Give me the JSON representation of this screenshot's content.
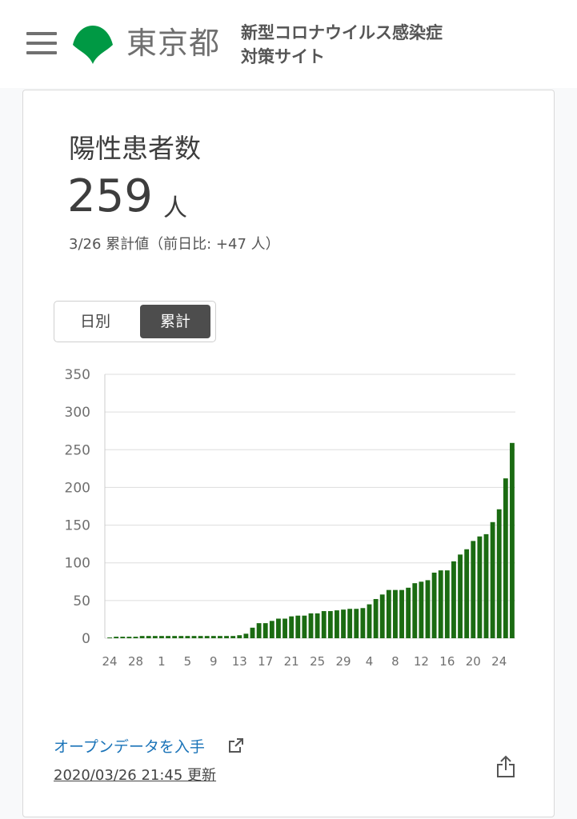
{
  "header": {
    "org_name": "東京都",
    "site_title_line1": "新型コロナウイルス感染症",
    "site_title_line2": "対策サイト",
    "menu_icon": "hamburger-menu-icon",
    "logo_icon": "tokyo-ginkgo-logo-icon",
    "logo_color": "#009944"
  },
  "card": {
    "title": "陽性患者数",
    "value": "259",
    "unit": "人",
    "sub_info": "3/26 累計値（前日比: +47 人）",
    "toggle": {
      "daily": "日別",
      "cumulative": "累計",
      "selected": "cumulative"
    },
    "open_data_link": "オープンデータを入手",
    "open_data_icon": "external-link-icon",
    "updated": "2020/03/26 21:45 更新",
    "share_icon": "share-icon"
  },
  "chart_data": {
    "type": "bar",
    "color": "#1b6b12",
    "ylim": [
      0,
      350
    ],
    "yticks": [
      0,
      50,
      100,
      150,
      200,
      250,
      300,
      350
    ],
    "xtick_labels": [
      "24",
      "28",
      "1",
      "5",
      "9",
      "13",
      "17",
      "21",
      "25",
      "29",
      "4",
      "8",
      "12",
      "16",
      "20",
      "24"
    ],
    "xtick_indices": [
      0,
      4,
      8,
      12,
      16,
      20,
      24,
      28,
      32,
      36,
      40,
      44,
      48,
      52,
      56,
      60
    ],
    "values": [
      1,
      2,
      2,
      2,
      2,
      3,
      3,
      3,
      3,
      3,
      3,
      3,
      3,
      3,
      3,
      3,
      3,
      3,
      3,
      3,
      4,
      6,
      14,
      20,
      20,
      23,
      26,
      26,
      29,
      30,
      30,
      33,
      33,
      36,
      36,
      37,
      38,
      39,
      39,
      40,
      45,
      52,
      58,
      64,
      64,
      64,
      67,
      73,
      75,
      77,
      87,
      90,
      90,
      102,
      111,
      118,
      129,
      135,
      138,
      154,
      171,
      212,
      259
    ]
  }
}
